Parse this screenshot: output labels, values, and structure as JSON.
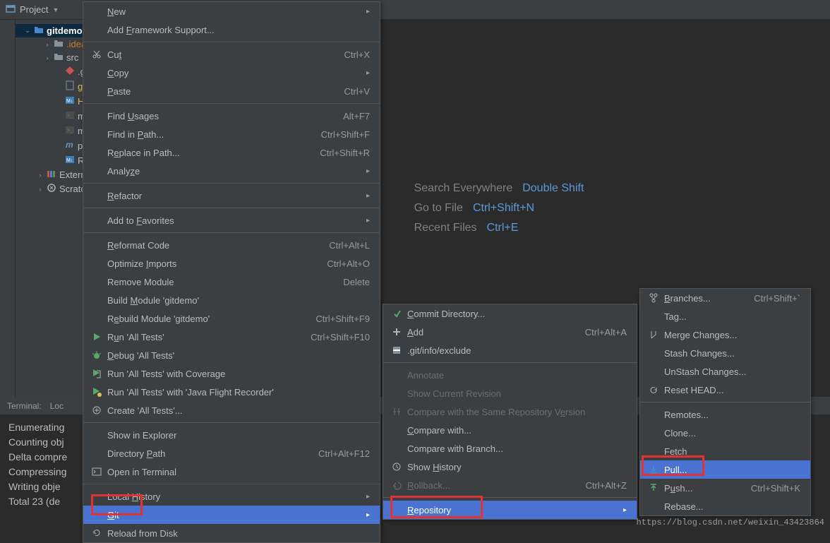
{
  "toolbar": {
    "project": "Project"
  },
  "tree": {
    "root": "gitdemo",
    "items": [
      {
        "name": ".idea",
        "indent": 54,
        "chevron": "›",
        "color": "folder-orange",
        "kind": "folder"
      },
      {
        "name": "src",
        "indent": 54,
        "chevron": "›",
        "color": "file-normal",
        "kind": "folder"
      },
      {
        "name": ".gitign",
        "indent": 70,
        "chevron": "",
        "color": "file-normal",
        "kind": "git"
      },
      {
        "name": "gitden",
        "indent": 70,
        "chevron": "",
        "color": "file-yellow",
        "kind": "file"
      },
      {
        "name": "HELP.n",
        "indent": 70,
        "chevron": "",
        "color": "file-yellow",
        "kind": "md"
      },
      {
        "name": "mvnw",
        "indent": 70,
        "chevron": "",
        "color": "file-normal",
        "kind": "sh"
      },
      {
        "name": "mvnw.",
        "indent": 70,
        "chevron": "",
        "color": "file-normal",
        "kind": "sh"
      },
      {
        "name": "pom.x",
        "indent": 70,
        "chevron": "",
        "color": "file-normal",
        "kind": "m"
      },
      {
        "name": "READN",
        "indent": 70,
        "chevron": "",
        "color": "file-normal",
        "kind": "md"
      }
    ],
    "external": "External L",
    "scratches": "Scratches"
  },
  "editor_hints": [
    {
      "label": "Search Everywhere",
      "key": "Double Shift"
    },
    {
      "label": "Go to File",
      "key": "Ctrl+Shift+N"
    },
    {
      "label": "Recent Files",
      "key": "Ctrl+E"
    }
  ],
  "terminal": {
    "title": "Terminal:",
    "tab": "Loc",
    "lines": [
      "Enumerating",
      "Counting obj",
      "Delta compre",
      "Compressing",
      "Writing obje",
      "Total 23 (de"
    ]
  },
  "menu1": [
    {
      "t": "item",
      "label": "New",
      "mnemonic": 0,
      "submenu": true
    },
    {
      "t": "item",
      "label": "Add Framework Support...",
      "mnemonic": 4
    },
    {
      "t": "sep"
    },
    {
      "t": "item",
      "label": "Cut",
      "mnemonic": 2,
      "shortcut": "Ctrl+X",
      "icon": "cut"
    },
    {
      "t": "item",
      "label": "Copy",
      "mnemonic": 0,
      "submenu": true
    },
    {
      "t": "item",
      "label": "Paste",
      "mnemonic": 0,
      "shortcut": "Ctrl+V"
    },
    {
      "t": "sep"
    },
    {
      "t": "item",
      "label": "Find Usages",
      "mnemonic": 5,
      "shortcut": "Alt+F7"
    },
    {
      "t": "item",
      "label": "Find in Path...",
      "mnemonic": 8,
      "shortcut": "Ctrl+Shift+F"
    },
    {
      "t": "item",
      "label": "Replace in Path...",
      "mnemonic": 1,
      "shortcut": "Ctrl+Shift+R"
    },
    {
      "t": "item",
      "label": "Analyze",
      "mnemonic": 5,
      "submenu": true
    },
    {
      "t": "sep"
    },
    {
      "t": "item",
      "label": "Refactor",
      "mnemonic": 0,
      "submenu": true
    },
    {
      "t": "sep"
    },
    {
      "t": "item",
      "label": "Add to Favorites",
      "mnemonic": 7,
      "submenu": true
    },
    {
      "t": "sep"
    },
    {
      "t": "item",
      "label": "Reformat Code",
      "mnemonic": 0,
      "shortcut": "Ctrl+Alt+L"
    },
    {
      "t": "item",
      "label": "Optimize Imports",
      "mnemonic": 9,
      "shortcut": "Ctrl+Alt+O"
    },
    {
      "t": "item",
      "label": "Remove Module",
      "shortcut": "Delete"
    },
    {
      "t": "item",
      "label": "Build Module 'gitdemo'",
      "mnemonic": 6
    },
    {
      "t": "item",
      "label": "Rebuild Module 'gitdemo'",
      "mnemonic": 1,
      "shortcut": "Ctrl+Shift+F9"
    },
    {
      "t": "item",
      "label": "Run 'All Tests'",
      "mnemonic": 1,
      "shortcut": "Ctrl+Shift+F10",
      "icon": "run"
    },
    {
      "t": "item",
      "label": "Debug 'All Tests'",
      "mnemonic": 0,
      "icon": "debug"
    },
    {
      "t": "item",
      "label": "Run 'All Tests' with Coverage",
      "icon": "coverage"
    },
    {
      "t": "item",
      "label": "Run 'All Tests' with 'Java Flight Recorder'",
      "icon": "jfr"
    },
    {
      "t": "item",
      "label": "Create 'All Tests'...",
      "icon": "create"
    },
    {
      "t": "sep"
    },
    {
      "t": "item",
      "label": "Show in Explorer"
    },
    {
      "t": "item",
      "label": "Directory Path",
      "mnemonic": 10,
      "shortcut": "Ctrl+Alt+F12"
    },
    {
      "t": "item",
      "label": "Open in Terminal",
      "icon": "terminal"
    },
    {
      "t": "sep"
    },
    {
      "t": "item",
      "label": "Local History",
      "mnemonic": 6,
      "submenu": true
    },
    {
      "t": "item",
      "label": "Git",
      "mnemonic": 0,
      "submenu": true,
      "selected": true
    },
    {
      "t": "item",
      "label": "Reload from Disk",
      "icon": "reload"
    }
  ],
  "menu2": [
    {
      "t": "item",
      "label": "Commit Directory...",
      "mnemonic": 0,
      "icon": "commit"
    },
    {
      "t": "item",
      "label": "Add",
      "mnemonic": 0,
      "shortcut": "Ctrl+Alt+A",
      "icon": "add"
    },
    {
      "t": "item",
      "label": ".git/info/exclude",
      "icon": "exclude"
    },
    {
      "t": "sep"
    },
    {
      "t": "item",
      "label": "Annotate",
      "disabled": true
    },
    {
      "t": "item",
      "label": "Show Current Revision",
      "disabled": true
    },
    {
      "t": "item",
      "label": "Compare with the Same Repository Version",
      "mnemonic": 34,
      "disabled": true,
      "icon": "compare"
    },
    {
      "t": "item",
      "label": "Compare with...",
      "mnemonic": 0
    },
    {
      "t": "item",
      "label": "Compare with Branch..."
    },
    {
      "t": "item",
      "label": "Show History",
      "mnemonic": 5,
      "icon": "history"
    },
    {
      "t": "item",
      "label": "Rollback...",
      "mnemonic": 0,
      "shortcut": "Ctrl+Alt+Z",
      "disabled": true,
      "icon": "rollback"
    },
    {
      "t": "sep"
    },
    {
      "t": "item",
      "label": "Repository",
      "mnemonic": 0,
      "submenu": true,
      "selected": true
    }
  ],
  "menu3": [
    {
      "t": "item",
      "label": "Branches...",
      "mnemonic": 0,
      "shortcut": "Ctrl+Shift+`",
      "icon": "branch"
    },
    {
      "t": "item",
      "label": "Tag..."
    },
    {
      "t": "item",
      "label": "Merge Changes...",
      "icon": "merge"
    },
    {
      "t": "item",
      "label": "Stash Changes..."
    },
    {
      "t": "item",
      "label": "UnStash Changes..."
    },
    {
      "t": "item",
      "label": "Reset HEAD...",
      "icon": "reset"
    },
    {
      "t": "sep"
    },
    {
      "t": "item",
      "label": "Remotes..."
    },
    {
      "t": "item",
      "label": "Clone..."
    },
    {
      "t": "item",
      "label": "Fetch"
    },
    {
      "t": "item",
      "label": "Pull...",
      "mnemonic": 0,
      "icon": "pull",
      "selected": true
    },
    {
      "t": "item",
      "label": "Push...",
      "mnemonic": 1,
      "shortcut": "Ctrl+Shift+K",
      "icon": "push"
    },
    {
      "t": "item",
      "label": "Rebase..."
    }
  ],
  "watermark": "https://blog.csdn.net/weixin_43423864"
}
